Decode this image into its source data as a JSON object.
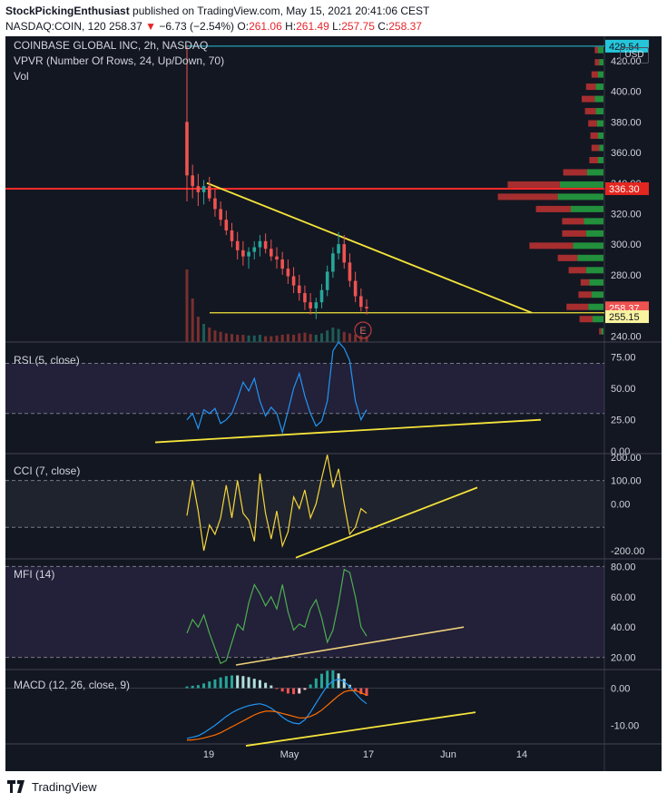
{
  "header": {
    "author": "StockPickingEnthusiast",
    "published_text": "published on TradingView.com, May 15, 2021 20:41:06 CEST",
    "symbol_line": "NASDAQ:COIN, 120",
    "last": "258.37",
    "change_arrow": "▼",
    "change": "−6.73 (−2.54%)",
    "o_label": "O:",
    "o": "261.06",
    "h_label": "H:",
    "h": "261.49",
    "l_label": "L:",
    "l": "257.75",
    "c_label": "C:",
    "c": "258.37"
  },
  "price_pane": {
    "title": "COINBASE GLOBAL INC, 2h, NASDAQ",
    "vpvr": "VPVR (Number Of Rows, 24, Up/Down, 70)",
    "vol": "Vol",
    "currency": "USD",
    "earnings_marker": "E",
    "price_labels": {
      "high": "429.54",
      "resistance": "336.30",
      "last": "258.37",
      "support": "255.15",
      "hidden": "340.00"
    }
  },
  "rsi": {
    "title": "RSI (5, close)"
  },
  "cci": {
    "title": "CCI (7, close)"
  },
  "mfi": {
    "title": "MFI (14)"
  },
  "macd": {
    "title": "MACD (12, 26, close, 9)"
  },
  "footer": {
    "brand": "TradingView"
  },
  "colors": {
    "bg": "#131722",
    "up": "#26a69a",
    "down": "#ef5350",
    "trend": "#f5e43a",
    "rsi": "#2196f3",
    "cci": "#f5d63d",
    "mfi": "#4caf50",
    "macd": "#2196f3",
    "signal": "#ff6d00",
    "resistance": "#ff2a2a",
    "high_line": "#26c6da"
  },
  "chart_data": [
    {
      "type": "candlestick",
      "pane": "price",
      "x_ticks": [
        "19",
        "May",
        "17",
        "Jun",
        "14"
      ],
      "y_ticks": [
        240,
        260,
        280,
        300,
        320,
        340,
        360,
        380,
        400,
        420
      ],
      "ylim": [
        236,
        436
      ],
      "series": [
        {
          "values": [
            [
              380,
              429.54,
              328,
              345
            ],
            [
              345,
              352,
              330,
              338
            ],
            [
              338,
              346,
              325,
              334
            ],
            [
              334,
              342,
              326,
              338
            ],
            [
              338,
              344,
              328,
              330
            ],
            [
              330,
              336,
              318,
              323
            ],
            [
              323,
              328,
              312,
              316
            ],
            [
              316,
              322,
              306,
              309
            ],
            [
              309,
              314,
              298,
              302
            ],
            [
              302,
              308,
              290,
              296
            ],
            [
              296,
              302,
              286,
              292
            ],
            [
              292,
              298,
              284,
              295
            ],
            [
              295,
              302,
              290,
              298
            ],
            [
              298,
              306,
              292,
              302
            ],
            [
              302,
              307,
              294,
              297
            ],
            [
              297,
              303,
              289,
              292
            ],
            [
              292,
              298,
              284,
              290
            ],
            [
              290,
              295,
              280,
              284
            ],
            [
              284,
              290,
              274,
              279
            ],
            [
              279,
              285,
              268,
              273
            ],
            [
              273,
              280,
              263,
              268
            ],
            [
              268,
              273,
              257,
              262
            ],
            [
              262,
              268,
              254,
              258
            ],
            [
              258,
              265,
              251,
              262
            ],
            [
              262,
              274,
              258,
              270
            ],
            [
              270,
              286,
              266,
              282
            ],
            [
              282,
              298,
              278,
              294
            ],
            [
              294,
              308,
              290,
              300
            ],
            [
              300,
              306,
              284,
              288
            ],
            [
              288,
              294,
              272,
              276
            ],
            [
              276,
              282,
              262,
              266
            ],
            [
              266,
              271,
              256,
              259
            ],
            [
              259,
              264,
              254,
              258
            ]
          ]
        }
      ],
      "volume": [
        100,
        60,
        35,
        25,
        20,
        16,
        14,
        12,
        11,
        10,
        10,
        9,
        9,
        10,
        8,
        8,
        9,
        10,
        11,
        10,
        12,
        13,
        11,
        10,
        12,
        16,
        20,
        18,
        14,
        12,
        10,
        9,
        8
      ],
      "vpvr_rows": [
        {
          "price": 427,
          "up": 0.05,
          "down": 0.03
        },
        {
          "price": 419,
          "up": 0.04,
          "down": 0.04
        },
        {
          "price": 411,
          "up": 0.05,
          "down": 0.06
        },
        {
          "price": 403,
          "up": 0.07,
          "down": 0.09
        },
        {
          "price": 395,
          "up": 0.08,
          "down": 0.12
        },
        {
          "price": 387,
          "up": 0.07,
          "down": 0.1
        },
        {
          "price": 379,
          "up": 0.06,
          "down": 0.08
        },
        {
          "price": 371,
          "up": 0.05,
          "down": 0.07
        },
        {
          "price": 363,
          "up": 0.04,
          "down": 0.07
        },
        {
          "price": 355,
          "up": 0.05,
          "down": 0.08
        },
        {
          "price": 347,
          "up": 0.15,
          "down": 0.22
        },
        {
          "price": 339,
          "up": 0.4,
          "down": 0.48
        },
        {
          "price": 331,
          "up": 0.42,
          "down": 0.55
        },
        {
          "price": 323,
          "up": 0.3,
          "down": 0.32
        },
        {
          "price": 315,
          "up": 0.18,
          "down": 0.2
        },
        {
          "price": 307,
          "up": 0.16,
          "down": 0.22
        },
        {
          "price": 299,
          "up": 0.28,
          "down": 0.4
        },
        {
          "price": 291,
          "up": 0.24,
          "down": 0.18
        },
        {
          "price": 283,
          "up": 0.16,
          "down": 0.16
        },
        {
          "price": 275,
          "up": 0.13,
          "down": 0.08
        },
        {
          "price": 267,
          "up": 0.11,
          "down": 0.12
        },
        {
          "price": 259,
          "up": 0.14,
          "down": 0.2
        },
        {
          "price": 251,
          "up": 0.1,
          "down": 0.12
        },
        {
          "price": 243,
          "up": 0.02,
          "down": 0.02
        }
      ],
      "horizontal_levels": [
        429.54,
        336.3,
        255.15,
        258.37
      ]
    },
    {
      "type": "line",
      "pane": "rsi",
      "y_ticks": [
        0,
        25,
        50,
        75
      ],
      "ylim": [
        -2,
        87
      ],
      "band": [
        30,
        70
      ],
      "series": [
        {
          "name": "RSI",
          "values": [
            25,
            30,
            18,
            33,
            30,
            34,
            22,
            25,
            30,
            42,
            55,
            48,
            58,
            40,
            28,
            35,
            30,
            15,
            32,
            50,
            62,
            44,
            30,
            20,
            24,
            40,
            80,
            87,
            82,
            72,
            40,
            25,
            33
          ]
        }
      ]
    },
    {
      "type": "line",
      "pane": "cci",
      "y_ticks": [
        -200,
        0,
        100,
        200
      ],
      "ylim": [
        -235,
        215
      ],
      "band": [
        -100,
        100
      ],
      "series": [
        {
          "name": "CCI",
          "values": [
            -50,
            100,
            -30,
            -200,
            -90,
            -130,
            -60,
            80,
            -60,
            100,
            -40,
            -70,
            -160,
            130,
            -40,
            -150,
            -30,
            -180,
            -120,
            30,
            -20,
            60,
            -60,
            0,
            110,
            210,
            70,
            150,
            0,
            -130,
            -100,
            -20,
            -40
          ]
        }
      ]
    },
    {
      "type": "line",
      "pane": "mfi",
      "y_ticks": [
        20,
        40,
        60,
        80
      ],
      "ylim": [
        12,
        85
      ],
      "band": [
        20,
        80
      ],
      "series": [
        {
          "name": "MFI",
          "values": [
            36,
            45,
            40,
            48,
            36,
            26,
            16,
            18,
            30,
            42,
            38,
            56,
            68,
            62,
            54,
            60,
            52,
            68,
            50,
            38,
            42,
            40,
            52,
            58,
            46,
            30,
            38,
            56,
            78,
            76,
            60,
            40,
            34
          ]
        }
      ]
    },
    {
      "type": "line",
      "pane": "macd",
      "y_ticks": [
        -10,
        0
      ],
      "ylim": [
        -15,
        5
      ],
      "series": [
        {
          "name": "MACD",
          "values": [
            -13.5,
            -13.2,
            -12.8,
            -12,
            -11,
            -10,
            -8.8,
            -7.6,
            -6.6,
            -5.8,
            -5.2,
            -4.7,
            -4.4,
            -4.2,
            -4.6,
            -5.4,
            -6.5,
            -7.8,
            -8.8,
            -9.4,
            -9.6,
            -8.5,
            -6.5,
            -4,
            -1.6,
            0.6,
            2,
            2.4,
            1.8,
            0.4,
            -1.4,
            -3,
            -4.2
          ]
        },
        {
          "name": "Signal",
          "values": [
            -14,
            -13.9,
            -13.7,
            -13.4,
            -13,
            -12.6,
            -12,
            -11.2,
            -10.4,
            -9.6,
            -8.8,
            -8,
            -7.2,
            -6.6,
            -6.2,
            -6.2,
            -6.4,
            -6.8,
            -7.2,
            -7.6,
            -8,
            -8,
            -7.6,
            -6.9,
            -5.9,
            -4.6,
            -3.3,
            -2,
            -1,
            -0.6,
            -0.7,
            -1.2,
            -1.9
          ]
        }
      ]
    }
  ]
}
